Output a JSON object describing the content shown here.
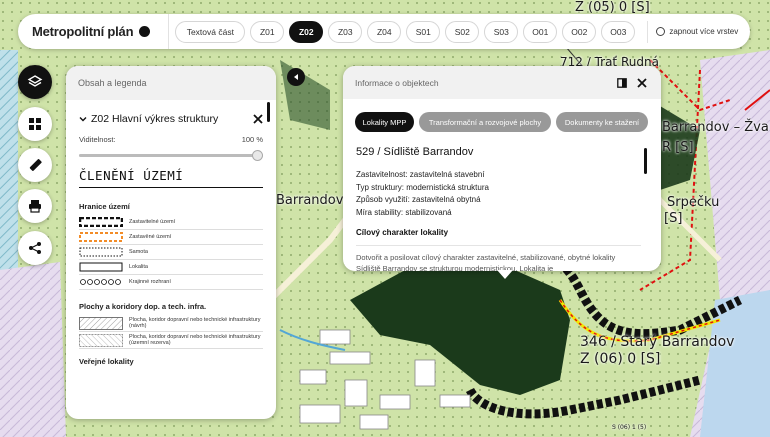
{
  "topbar": {
    "title": "Metropolitní plán",
    "tabs": [
      {
        "label": "Textová část",
        "active": false
      },
      {
        "label": "Z01",
        "active": false
      },
      {
        "label": "Z02",
        "active": true
      },
      {
        "label": "Z03",
        "active": false
      },
      {
        "label": "Z04",
        "active": false
      },
      {
        "label": "S01",
        "active": false
      },
      {
        "label": "S02",
        "active": false
      },
      {
        "label": "S03",
        "active": false
      },
      {
        "label": "O01",
        "active": false
      },
      {
        "label": "O02",
        "active": false
      },
      {
        "label": "O03",
        "active": false
      }
    ],
    "multi_layer_toggle": "zapnout více vrstev"
  },
  "map_labels": {
    "top_right_code": "Z (05) 0 [S]",
    "tr_partial": "712 / Trať Rudná",
    "barrandov_zv": "Barrandov – Žva",
    "r_s": "R [S]",
    "srpecku": "Srpečku",
    "srpecku_s": "[S]",
    "barrandov_left": "Barrandov",
    "stary_barrandov": "346 / Starý Barrandov",
    "stary_code": "Z (06) 0 [S]",
    "bottom_code": "S (06) 1 (5)"
  },
  "legend": {
    "header": "Obsah a legenda",
    "layer_title": "Z02 Hlavní výkres struktury",
    "visibility_label": "Viditelnost:",
    "visibility_value": "100 %",
    "visibility_fraction": 1.0,
    "section_title": "ČLENĚNÍ ÚZEMÍ",
    "group1_title": "Hranice území",
    "group1_items": [
      "Zastavitelné území",
      "Zastavěné území",
      "Samota",
      "Lokalita",
      "Krajinné rozhraní"
    ],
    "group2_title": "Plochy a koridory dop. a tech. infra.",
    "group2_items": [
      "Plocha, koridor dopravní nebo technické infrastruktury (návrh)",
      "Plocha, koridor dopravní nebo technické infrastruktury (územní rezerva)"
    ],
    "cut_text": "Veřejné lokality"
  },
  "info": {
    "header": "Informace o objektech",
    "tabs": [
      {
        "label": "Lokality MPP",
        "active": true
      },
      {
        "label": "Transformační a rozvojové plochy",
        "active": false
      },
      {
        "label": "Dokumenty ke stažení",
        "active": false
      }
    ],
    "title": "529 / Sídliště Barrandov",
    "properties": [
      "Zastavitelnost: zastavitelná stavební",
      "Typ struktury: modernistická struktura",
      "Způsob využití: zastavitelná obytná",
      "Míra stability: stabilizovaná"
    ],
    "section": "Cílový charakter lokality",
    "description": "Dotvořit a posilovat cílový charakter zastavitelné, stabilizované, obytné lokality Sídliště Barrandov se strukturou modernistickou. Lokalita je"
  },
  "colors": {
    "map_green": "#cfe3a8",
    "map_dark": "#1b3a1b",
    "active_dark": "#111111",
    "pill_gray": "#999999",
    "boundary_yellow": "#f2e600",
    "boundary_red": "#e01010"
  }
}
